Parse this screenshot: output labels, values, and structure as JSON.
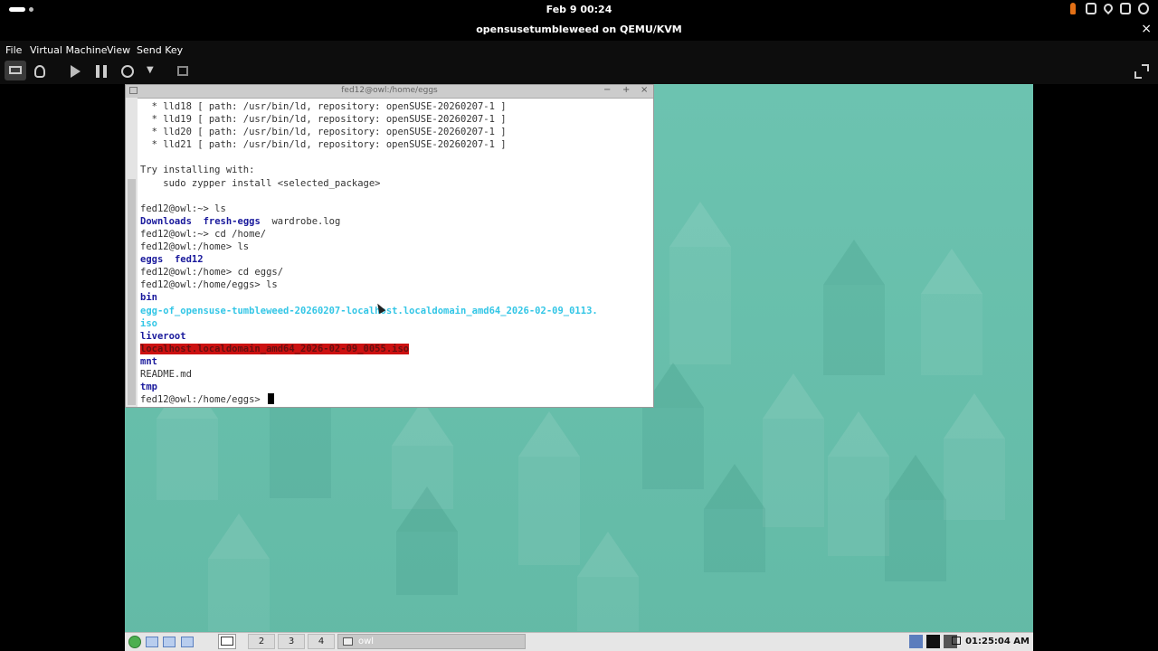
{
  "gnome_bar": {
    "clock": "Feb 9  00:24"
  },
  "vm_window": {
    "title": "opensusetumbleweed on QEMU/KVM",
    "close_glyph": "×"
  },
  "menu": [
    "File",
    "Virtual Machine",
    "View",
    "Send Key"
  ],
  "toolbar_icons": [
    "monitor-icon",
    "bulb-icon",
    "play-icon",
    "pause-icon",
    "power-icon",
    "chevron-down-icon",
    "screens-icon",
    "fullscreen-icon"
  ],
  "terminal": {
    "title": "fed12@owl:/home/eggs",
    "buttons": [
      "−",
      "+",
      "×"
    ],
    "lines": [
      {
        "style": "n",
        "text": "  * lld18 [ path: /usr/bin/ld, repository: openSUSE-20260207-1 ]"
      },
      {
        "style": "n",
        "text": "  * lld19 [ path: /usr/bin/ld, repository: openSUSE-20260207-1 ]"
      },
      {
        "style": "n",
        "text": "  * lld20 [ path: /usr/bin/ld, repository: openSUSE-20260207-1 ]"
      },
      {
        "style": "n",
        "text": "  * lld21 [ path: /usr/bin/ld, repository: openSUSE-20260207-1 ]"
      },
      {
        "style": "n",
        "text": ""
      },
      {
        "style": "n",
        "text": "Try installing with:"
      },
      {
        "style": "n",
        "text": "    sudo zypper install <selected_package>"
      },
      {
        "style": "n",
        "text": ""
      },
      {
        "style": "n",
        "text": "fed12@owl:~> ls"
      },
      {
        "style": "ls1",
        "a": "Downloads",
        "b": "fresh-eggs",
        "c": "wardrobe.log"
      },
      {
        "style": "n",
        "text": "fed12@owl:~> cd /home/"
      },
      {
        "style": "n",
        "text": "fed12@owl:/home> ls"
      },
      {
        "style": "ls2",
        "a": "eggs",
        "b": "fed12"
      },
      {
        "style": "n",
        "text": "fed12@owl:/home> cd eggs/"
      },
      {
        "style": "n",
        "text": "fed12@owl:/home/eggs> ls"
      },
      {
        "style": "dir",
        "text": "bin"
      },
      {
        "style": "iso",
        "text": "egg-of_opensuse-tumbleweed-20260207-localhost.localdomain_amd64_2026-02-09_0113."
      },
      {
        "style": "iso",
        "text": "iso"
      },
      {
        "style": "dir",
        "text": "liveroot"
      },
      {
        "style": "red",
        "text": "localhost.localdomain_amd64_2026-02-09_0055.iso"
      },
      {
        "style": "dir",
        "text": "mnt"
      },
      {
        "style": "n",
        "text": "README.md"
      },
      {
        "style": "dir",
        "text": "tmp"
      },
      {
        "style": "prompt",
        "text": "fed12@owl:/home/eggs> "
      }
    ]
  },
  "taskbar": {
    "workspaces": [
      "2",
      "3",
      "4"
    ],
    "window_button": "owl",
    "clock": "01:25:04 AM"
  },
  "colors": {
    "desktop": "#66bdaa",
    "dir": "#1a1a9c",
    "iso": "#33c6e6",
    "highlight": "#cc1111"
  }
}
